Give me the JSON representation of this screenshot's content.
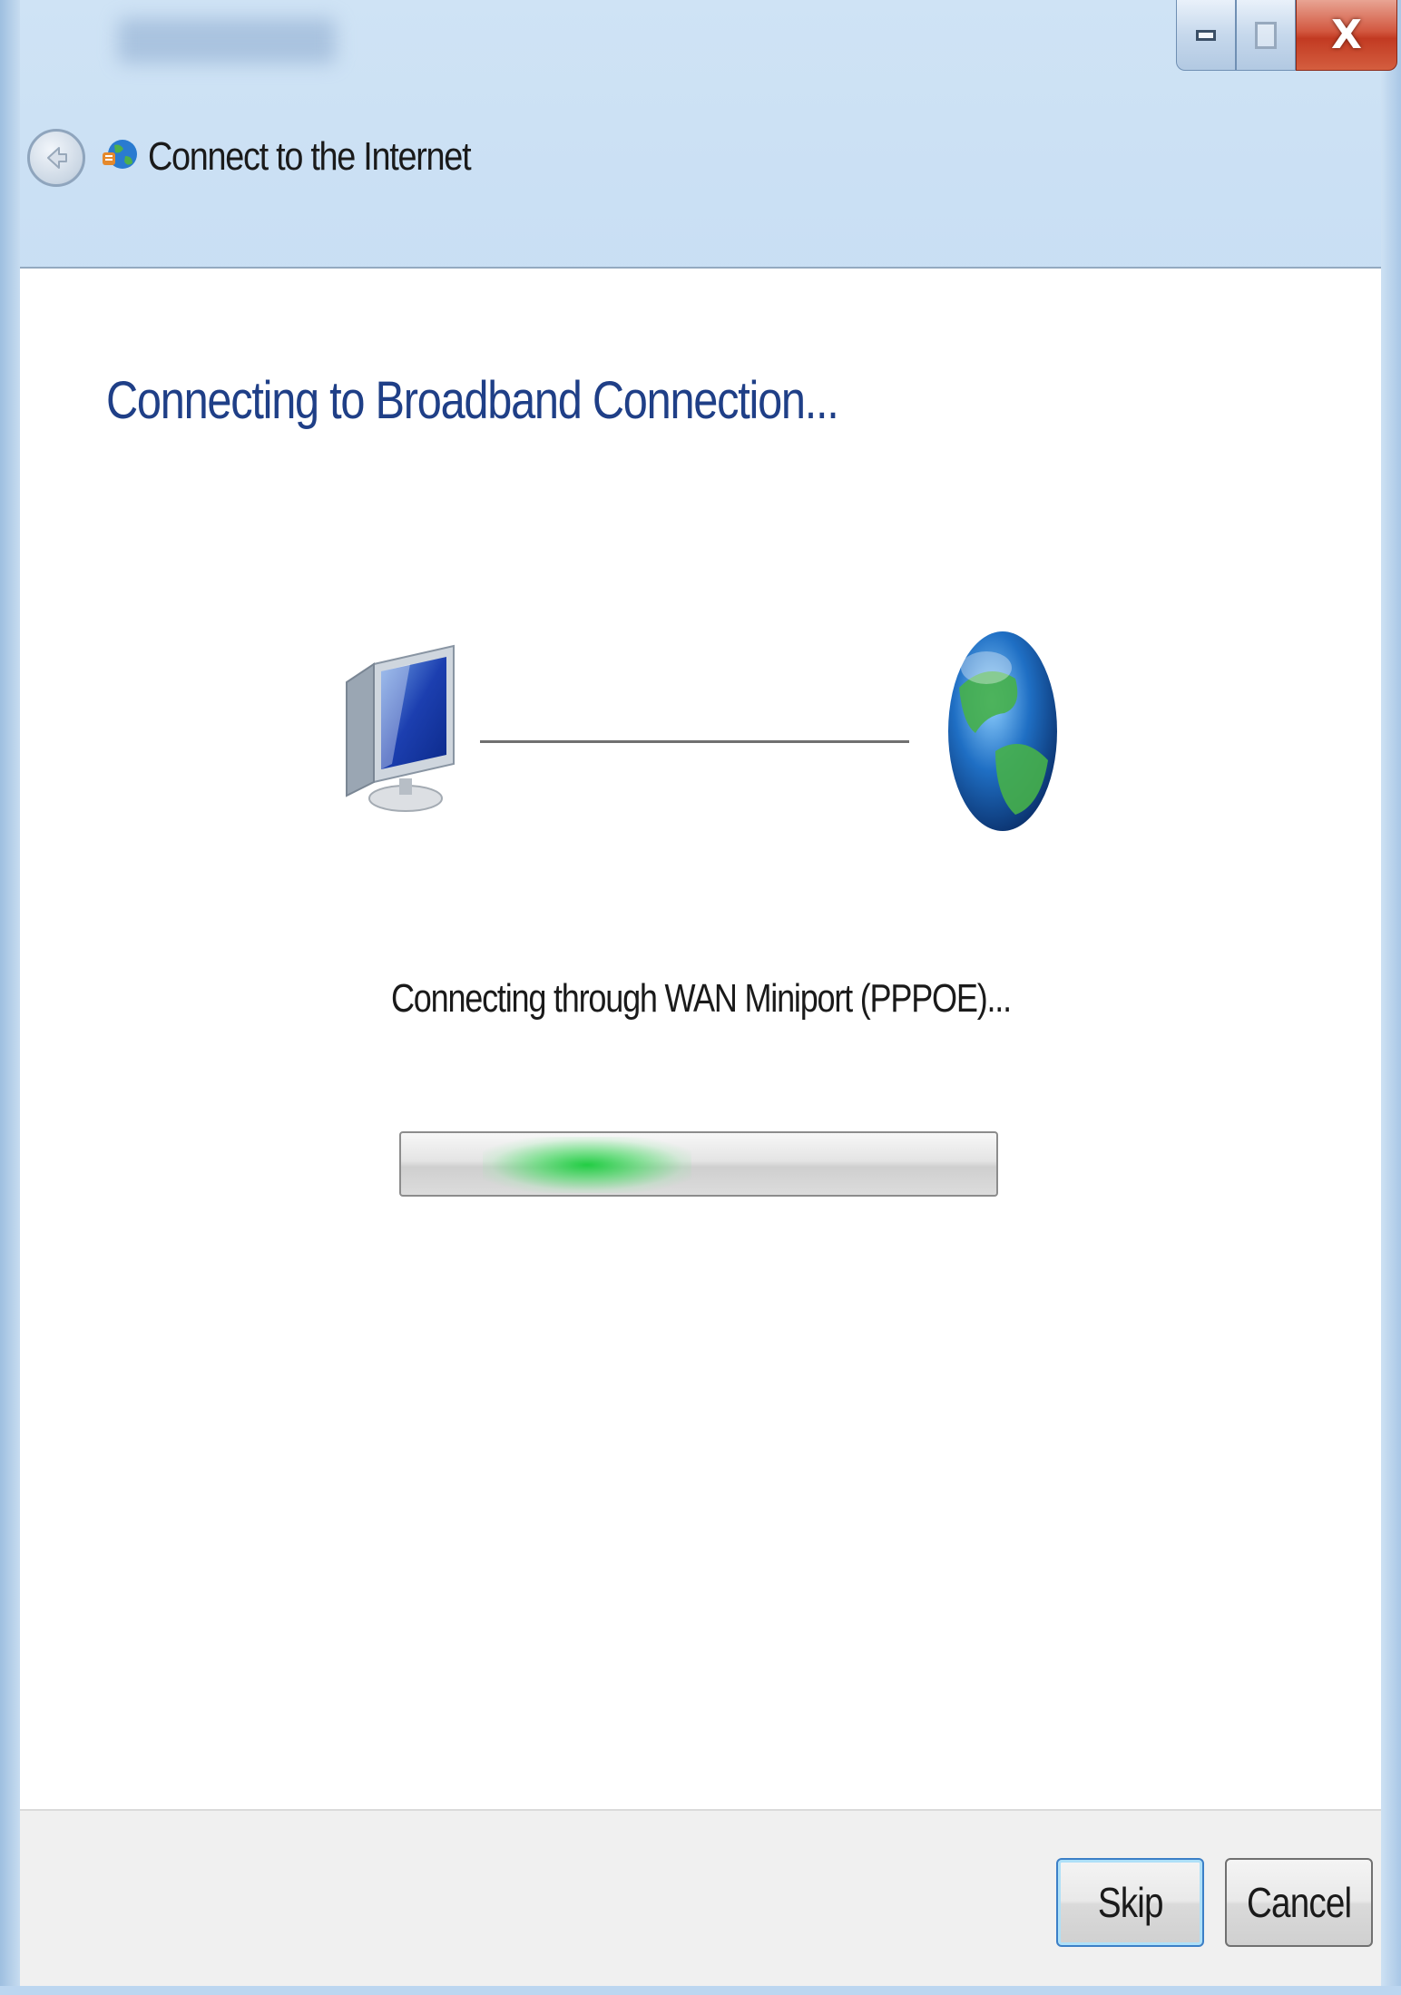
{
  "window": {
    "title": "Connect to the Internet",
    "caption_buttons": {
      "minimize_icon": "minimize-icon",
      "maximize_icon": "maximize-icon",
      "close_label": "X"
    }
  },
  "navigation": {
    "back_icon": "back-arrow-icon",
    "app_icon": "network-globe-icon"
  },
  "main": {
    "heading": "Connecting to Broadband Connection...",
    "diagram": {
      "left_icon": "computer-icon",
      "right_icon": "globe-icon"
    },
    "status": "Connecting through WAN Miniport (PPPOE)...",
    "progress": {
      "type": "indeterminate marquee",
      "color": "#1ccd3c"
    }
  },
  "footer": {
    "skip_label": "Skip",
    "cancel_label": "Cancel"
  },
  "colors": {
    "heading": "#1f3f87",
    "frame": "#bcd6f0",
    "close_button": "#c23a22",
    "focus_button_border": "#3b7fc7"
  }
}
